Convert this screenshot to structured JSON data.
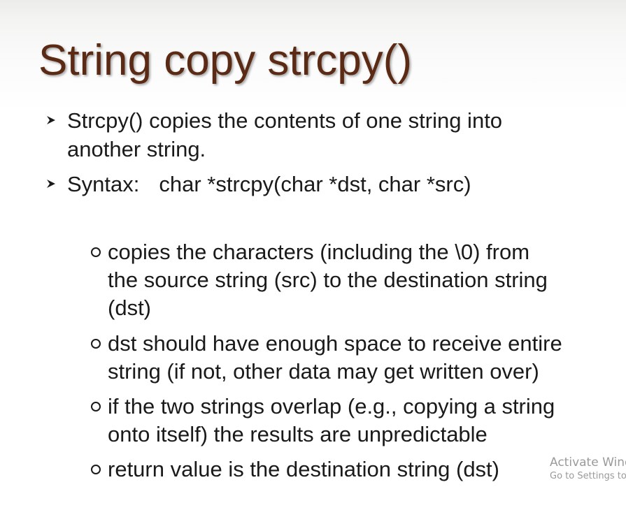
{
  "slide": {
    "title": "String copy strcpy()",
    "bullets": [
      {
        "lines": [
          "Strcpy() copies the contents  of one string into",
          "another string."
        ]
      },
      {
        "label": "Syntax:",
        "code": "char *strcpy(char *dst, char *src)"
      }
    ],
    "sub_bullets": [
      {
        "lines": [
          "copies the characters (including the \\0) from",
          "the source string (src) to the destination string",
          "(dst)"
        ]
      },
      {
        "lines": [
          "dst should have enough space to receive entire",
          "string (if not, other data may get written over)"
        ]
      },
      {
        "lines": [
          "if the two strings overlap (e.g., copying a string",
          "onto itself) the results are unpredictable"
        ]
      },
      {
        "lines": [
          "return value is the destination string (dst)"
        ]
      }
    ]
  },
  "watermark": {
    "title": "Activate Windows",
    "subtitle": "Go to Settings to activate Windows."
  },
  "colors": {
    "title": "#5b2a14",
    "body_text": "#1a1a1a",
    "watermark": "#9a9a9a"
  },
  "icons": {
    "bullet": "arrowhead-bullet-icon",
    "sub_bullet": "hollow-circle-bullet-icon"
  }
}
